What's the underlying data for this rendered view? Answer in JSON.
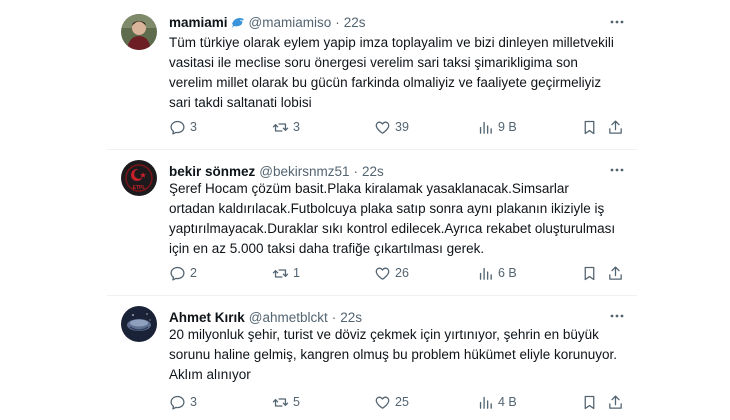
{
  "tweets": [
    {
      "name": "mamiami",
      "badge_icon": "dolphin-emoji",
      "handle": "@mamiamiso",
      "separator": "·",
      "time": "22s",
      "lines": [
        "Tüm türkiye olarak eylem yapip imza toplayalim ve bizi dinleyen milletvekili",
        "vasitasi ile meclise soru önergesi verelim sari taksi şimarikligima son",
        "verelim millet olarak bu gücün farkinda olmaliyiz ve faaliyete geçirmeliyiz",
        "sari takdi saltanati lobisi"
      ],
      "replies": "3",
      "retweets": "3",
      "likes": "39",
      "views": "9 B"
    },
    {
      "name": "bekir sönmez",
      "handle": "@bekirsnmz51",
      "separator": "·",
      "time": "22s",
      "avatar_text": "ETPL",
      "lines": [
        "Şeref Hocam çözüm basit.Plaka kiralamak yasaklanacak.Simsarlar",
        "ortadan kaldırılacak.Futbolcuya plaka satıp sonra aynı plakanın ikiziyle iş",
        "yaptırılmayacak.Duraklar sıkı kontrol edilecek.Ayrıca rekabet oluşturulması",
        "için en az 5.000 taksi daha trafiğe çıkartılması gerek."
      ],
      "replies": "2",
      "retweets": "1",
      "likes": "26",
      "views": "6 B"
    },
    {
      "name": "Ahmet Kırık",
      "handle": "@ahmetblckt",
      "separator": "·",
      "time": "22s",
      "lines": [
        "20 milyonluk şehir, turist ve döviz çekmek için yırtınıyor, şehrin en büyük",
        "sorunu haline gelmiş, kangren olmuş bu problem hükümet eliyle korunuyor.",
        "Aklım alınıyor"
      ],
      "replies": "3",
      "retweets": "5",
      "likes": "25",
      "views": "4 B"
    }
  ]
}
